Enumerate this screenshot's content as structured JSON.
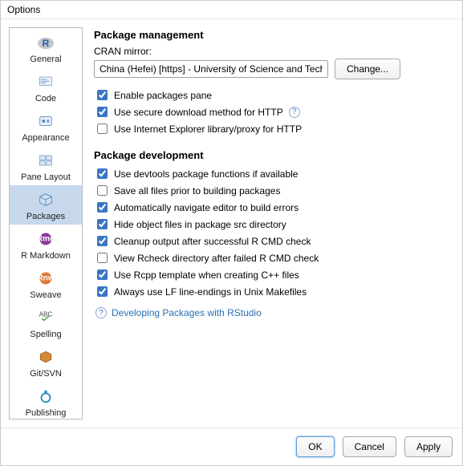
{
  "window": {
    "title": "Options"
  },
  "sidebar": {
    "items": [
      {
        "label": "General",
        "icon": "r-logo-icon",
        "selected": false
      },
      {
        "label": "Code",
        "icon": "code-icon",
        "selected": false
      },
      {
        "label": "Appearance",
        "icon": "palette-icon",
        "selected": false
      },
      {
        "label": "Pane Layout",
        "icon": "layout-icon",
        "selected": false
      },
      {
        "label": "Packages",
        "icon": "package-icon",
        "selected": true
      },
      {
        "label": "R Markdown",
        "icon": "rmarkdown-icon",
        "selected": false
      },
      {
        "label": "Sweave",
        "icon": "sweave-icon",
        "selected": false
      },
      {
        "label": "Spelling",
        "icon": "spelling-icon",
        "selected": false
      },
      {
        "label": "Git/SVN",
        "icon": "git-icon",
        "selected": false
      },
      {
        "label": "Publishing",
        "icon": "publish-icon",
        "selected": false
      }
    ]
  },
  "management": {
    "title": "Package management",
    "mirror_label": "CRAN mirror:",
    "mirror_value": "China (Hefei) [https] - University of Science and Technology",
    "change_label": "Change...",
    "enable_pane": {
      "label": "Enable packages pane",
      "checked": true
    },
    "secure_http": {
      "label": "Use secure download method for HTTP",
      "checked": true
    },
    "ie_proxy": {
      "label": "Use Internet Explorer library/proxy for HTTP",
      "checked": false
    }
  },
  "development": {
    "title": "Package development",
    "devtools": {
      "label": "Use devtools package functions if available",
      "checked": true
    },
    "save_all": {
      "label": "Save all files prior to building packages",
      "checked": false
    },
    "auto_nav": {
      "label": "Automatically navigate editor to build errors",
      "checked": true
    },
    "hide_obj": {
      "label": "Hide object files in package src directory",
      "checked": true
    },
    "cleanup": {
      "label": "Cleanup output after successful R CMD check",
      "checked": true
    },
    "view_rcheck": {
      "label": "View Rcheck directory after failed R CMD check",
      "checked": false
    },
    "rcpp": {
      "label": "Use Rcpp template when creating C++ files",
      "checked": true
    },
    "lf_endings": {
      "label": "Always use LF line-endings in Unix Makefiles",
      "checked": true
    },
    "help_link": "Developing Packages with RStudio"
  },
  "footer": {
    "ok": "OK",
    "cancel": "Cancel",
    "apply": "Apply"
  }
}
